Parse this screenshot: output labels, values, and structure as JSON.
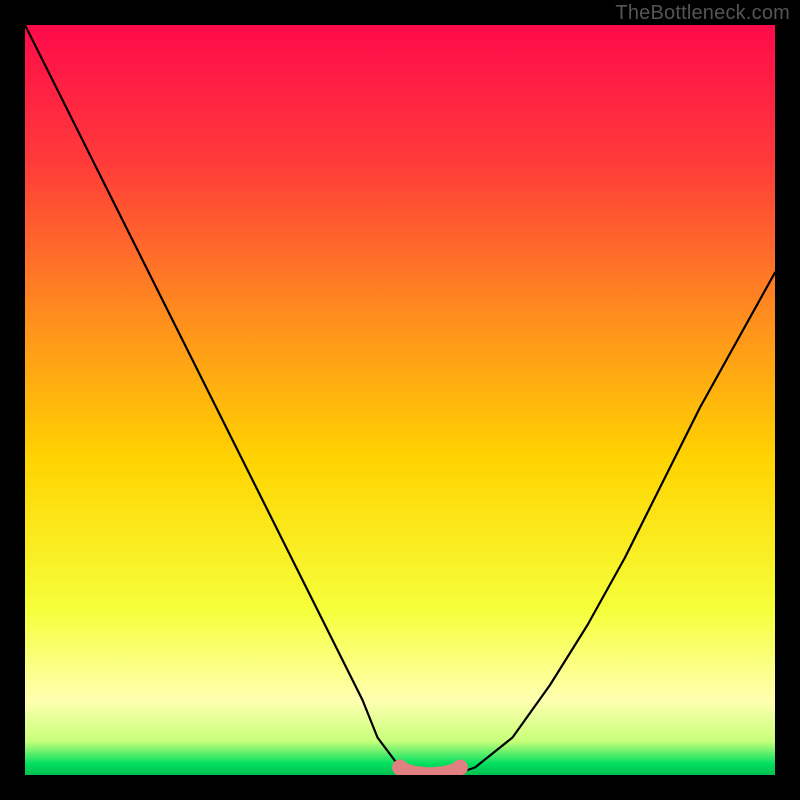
{
  "watermark": "TheBottleneck.com",
  "chart_data": {
    "type": "line",
    "title": "",
    "xlabel": "",
    "ylabel": "",
    "xlim": [
      0,
      100
    ],
    "ylim": [
      0,
      100
    ],
    "series": [
      {
        "name": "bottleneck-curve",
        "x": [
          0,
          5,
          10,
          15,
          20,
          25,
          30,
          35,
          40,
          45,
          47,
          50,
          53,
          55,
          57,
          60,
          65,
          70,
          75,
          80,
          85,
          90,
          95,
          100
        ],
        "y": [
          100,
          90,
          80,
          70,
          60,
          50,
          40,
          30,
          20,
          10,
          5,
          1,
          0,
          0,
          0,
          1,
          5,
          12,
          20,
          29,
          39,
          49,
          58,
          67
        ]
      }
    ],
    "highlight": {
      "name": "minimum-plateau",
      "x": [
        50,
        52,
        54,
        56,
        58
      ],
      "y": [
        1,
        0.4,
        0.2,
        0.4,
        1
      ]
    },
    "background_gradient": {
      "stops": [
        {
          "pos": 0.0,
          "color": "#ff0a4a"
        },
        {
          "pos": 0.18,
          "color": "#ff3a3a"
        },
        {
          "pos": 0.38,
          "color": "#ff8a1f"
        },
        {
          "pos": 0.58,
          "color": "#ffd400"
        },
        {
          "pos": 0.78,
          "color": "#f5ff3a"
        },
        {
          "pos": 0.9,
          "color": "#ffffb0"
        },
        {
          "pos": 0.955,
          "color": "#c8ff7a"
        },
        {
          "pos": 0.985,
          "color": "#00e060"
        },
        {
          "pos": 1.0,
          "color": "#00c050"
        }
      ]
    }
  }
}
